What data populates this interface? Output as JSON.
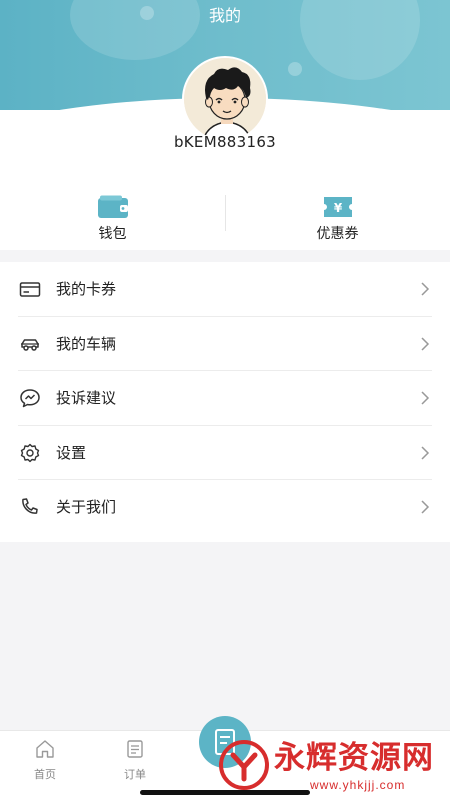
{
  "page": {
    "title": "我的"
  },
  "profile": {
    "username": "bKEM883163",
    "avatar_icon": "cartoon-boy-avatar"
  },
  "quick_actions": [
    {
      "label": "钱包",
      "icon": "wallet-icon"
    },
    {
      "label": "优惠券",
      "icon": "coupon-icon"
    }
  ],
  "menu": {
    "items": [
      {
        "label": "我的卡券",
        "icon": "card-icon"
      },
      {
        "label": "我的车辆",
        "icon": "car-icon"
      },
      {
        "label": "投诉建议",
        "icon": "chat-bubble-icon"
      },
      {
        "label": "设置",
        "icon": "gear-icon"
      },
      {
        "label": "关于我们",
        "icon": "phone-icon"
      }
    ]
  },
  "tabbar": {
    "items": [
      {
        "label": "首页",
        "icon": "home-icon"
      },
      {
        "label": "订单",
        "icon": "order-icon"
      }
    ]
  },
  "watermark": {
    "text": "永辉资源网",
    "url": "www.yhkjjj.com"
  },
  "colors": {
    "accent": "#5cb4c6",
    "watermark": "#d72d2d",
    "background": "#f4f4f6"
  }
}
